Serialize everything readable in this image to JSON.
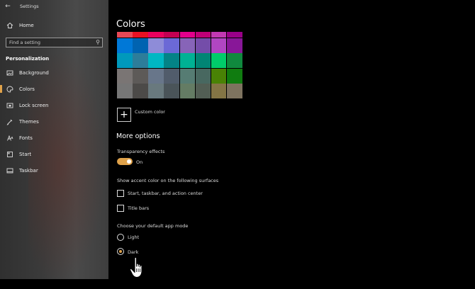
{
  "window": {
    "title": "Settings"
  },
  "sidebar": {
    "home_label": "Home",
    "search_placeholder": "Find a setting",
    "section_title": "Personalization",
    "items": [
      {
        "label": "Background",
        "icon": "picture-icon",
        "active": false
      },
      {
        "label": "Colors",
        "icon": "palette-icon",
        "active": true
      },
      {
        "label": "Lock screen",
        "icon": "lock-screen-icon",
        "active": false
      },
      {
        "label": "Themes",
        "icon": "themes-icon",
        "active": false
      },
      {
        "label": "Fonts",
        "icon": "fonts-icon",
        "active": false
      },
      {
        "label": "Start",
        "icon": "start-icon",
        "active": false
      },
      {
        "label": "Taskbar",
        "icon": "taskbar-icon",
        "active": false
      }
    ]
  },
  "main": {
    "title": "Colors",
    "swatch_rows": [
      [
        "#e74856",
        "#e81123",
        "#ea005e",
        "#c30052",
        "#e3008c",
        "#bf0077",
        "#c239b3",
        "#9a0089"
      ],
      [
        "#0078d7",
        "#0063b1",
        "#8e8cd8",
        "#6b69d6",
        "#8764b8",
        "#744da9",
        "#b146c2",
        "#881798"
      ],
      [
        "#0099bc",
        "#2d7d9a",
        "#00b7c3",
        "#038387",
        "#00b294",
        "#018574",
        "#00cc6a",
        "#10893e"
      ],
      [
        "#7a7574",
        "#5d5a58",
        "#68768a",
        "#515c6b",
        "#567c73",
        "#486860",
        "#498205",
        "#107c10"
      ],
      [
        "#767676",
        "#4c4a48",
        "#69797e",
        "#4a5459",
        "#647c64",
        "#525e54",
        "#847545",
        "#7e735f"
      ]
    ],
    "custom_color_label": "Custom color",
    "more_options_title": "More options",
    "transparency_label": "Transparency effects",
    "transparency_state": "On",
    "accent_surfaces_label": "Show accent color on the following surfaces",
    "checkbox_start": "Start, taskbar, and action center",
    "checkbox_titlebars": "Title bars",
    "app_mode_label": "Choose your default app mode",
    "radio_light": "Light",
    "radio_dark": "Dark"
  },
  "colors": {
    "accent": "#e0a24a"
  }
}
